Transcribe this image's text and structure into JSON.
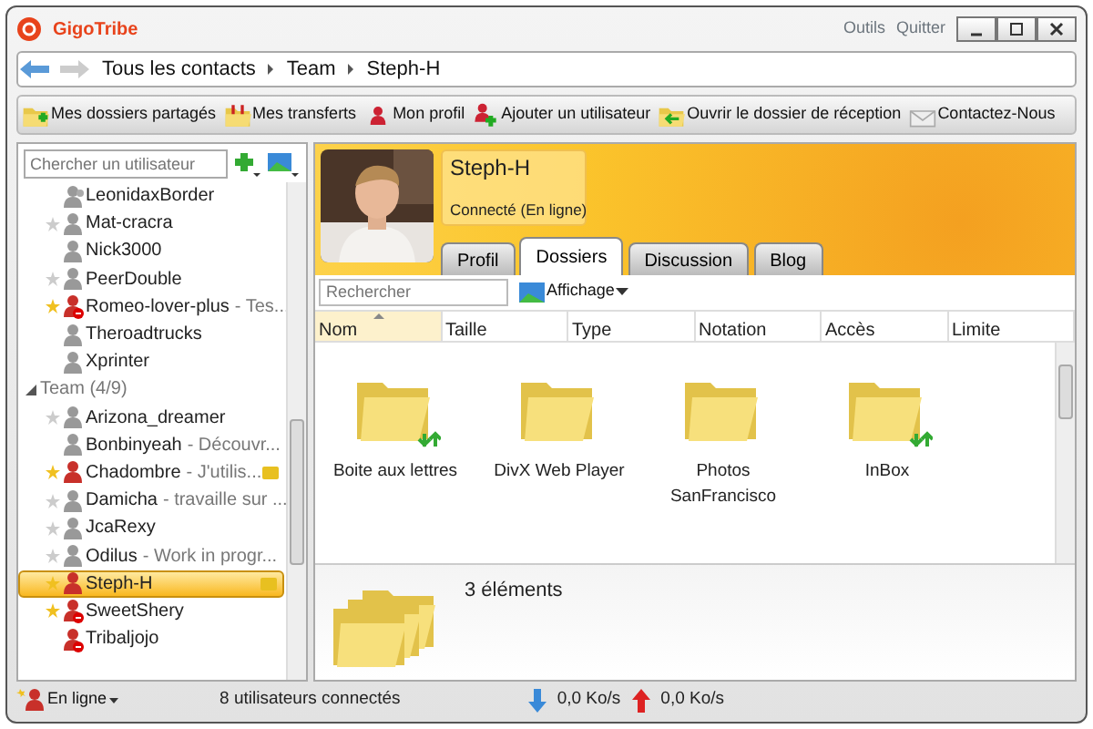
{
  "app": {
    "logo": "GigoTribe",
    "menu": [
      "Outils",
      "Quitter"
    ]
  },
  "breadcrumb": [
    "Tous les contacts",
    "Team",
    "Steph-H"
  ],
  "toolbar": [
    {
      "label": "Mes dossiers partagés",
      "kind": "share"
    },
    {
      "label": "Mes transferts",
      "kind": "transfer"
    },
    {
      "label": "Mon profil",
      "kind": "profile"
    },
    {
      "label": "Ajouter un utilisateur",
      "kind": "adduser"
    },
    {
      "label": "Ouvrir le dossier de réception",
      "kind": "inbox"
    },
    {
      "label": "Contactez-Nous",
      "kind": "mail"
    }
  ],
  "user_search": {
    "placeholder": "Chercher un utilisateur"
  },
  "contacts": [
    {
      "kind": "multi",
      "name": "LeonidaxBorder",
      "online": false,
      "blocked": false,
      "starred": false,
      "favorite": false,
      "selected": false
    },
    {
      "kind": "user",
      "name": "Mat-cracra",
      "online": false,
      "blocked": false,
      "starred": true,
      "favorite": false,
      "selected": false
    },
    {
      "kind": "user",
      "name": "Nick3000",
      "online": false,
      "blocked": false,
      "starred": false,
      "favorite": false,
      "selected": false
    },
    {
      "kind": "user",
      "name": "PeerDouble",
      "online": false,
      "blocked": false,
      "starred": true,
      "favorite": false,
      "selected": false
    },
    {
      "kind": "user",
      "name": "Romeo-lover-plus",
      "note": "- Tes...",
      "online": true,
      "blocked": true,
      "starred": true,
      "favorite": true,
      "selected": false
    },
    {
      "kind": "user",
      "name": "Theroadtrucks",
      "online": false,
      "blocked": false,
      "starred": false,
      "favorite": false,
      "selected": false
    },
    {
      "kind": "user",
      "name": "Xprinter",
      "online": false,
      "blocked": false,
      "starred": false,
      "favorite": false,
      "selected": false
    },
    {
      "kind": "group",
      "name": "Team (4/9)",
      "expanded": true,
      "children": [
        {
          "kind": "user",
          "name": "Arizona_dreamer",
          "online": false,
          "blocked": false,
          "starred": true,
          "favorite": false,
          "selected": false
        },
        {
          "kind": "user",
          "name": "Bonbinyeah",
          "note": "- Découvr...",
          "online": false,
          "blocked": false,
          "starred": false,
          "favorite": false,
          "selected": false
        },
        {
          "kind": "user",
          "name": "Chadombre",
          "note": "- J'utilis...",
          "online": true,
          "blocked": false,
          "starred": true,
          "favorite": true,
          "shared": true,
          "selected": false
        },
        {
          "kind": "user",
          "name": "Damicha",
          "note": "- travaille sur ...",
          "online": false,
          "blocked": false,
          "starred": true,
          "favorite": false,
          "selected": false
        },
        {
          "kind": "user",
          "name": "JcaRexy",
          "online": false,
          "blocked": false,
          "starred": true,
          "favorite": false,
          "selected": false
        },
        {
          "kind": "user",
          "name": "Odilus",
          "note": "- Work in progr...",
          "online": false,
          "blocked": false,
          "starred": true,
          "favorite": false,
          "selected": false
        },
        {
          "kind": "user",
          "name": "Steph-H",
          "online": true,
          "blocked": false,
          "starred": true,
          "favorite": true,
          "shared": true,
          "selected": true
        },
        {
          "kind": "user",
          "name": "SweetShery",
          "online": true,
          "blocked": true,
          "starred": true,
          "favorite": true,
          "selected": false
        },
        {
          "kind": "user",
          "name": "Tribaljojo",
          "online": true,
          "blocked": true,
          "starred": false,
          "favorite": false,
          "selected": false
        }
      ]
    }
  ],
  "profile": {
    "name": "Steph-H",
    "status": "Connecté (En ligne)"
  },
  "tabs": [
    {
      "label": "Profil",
      "selected": false
    },
    {
      "label": "Dossiers",
      "selected": true
    },
    {
      "label": "Discussion",
      "selected": false
    },
    {
      "label": "Blog",
      "selected": false
    }
  ],
  "folder_search": {
    "placeholder": "Rechercher"
  },
  "view_button": "Affichage",
  "columns": [
    {
      "label": "Nom",
      "sorted": true
    },
    {
      "label": "Taille",
      "sorted": false
    },
    {
      "label": "Type",
      "sorted": false
    },
    {
      "label": "Notation",
      "sorted": false
    },
    {
      "label": "Accès",
      "sorted": false
    },
    {
      "label": "Limite",
      "sorted": false
    }
  ],
  "folders": [
    {
      "name": "Boite aux lettres",
      "sync": true
    },
    {
      "name": "DivX Web Player",
      "sync": false
    },
    {
      "name": "Photos SanFrancisco",
      "sync": false
    },
    {
      "name": "InBox",
      "sync": true
    }
  ],
  "summary": "3 éléments",
  "status_bar": {
    "presence": "En ligne",
    "users": "8 utilisateurs connectés",
    "download": "0,0 Ko/s",
    "upload": "0,0 Ko/s"
  }
}
